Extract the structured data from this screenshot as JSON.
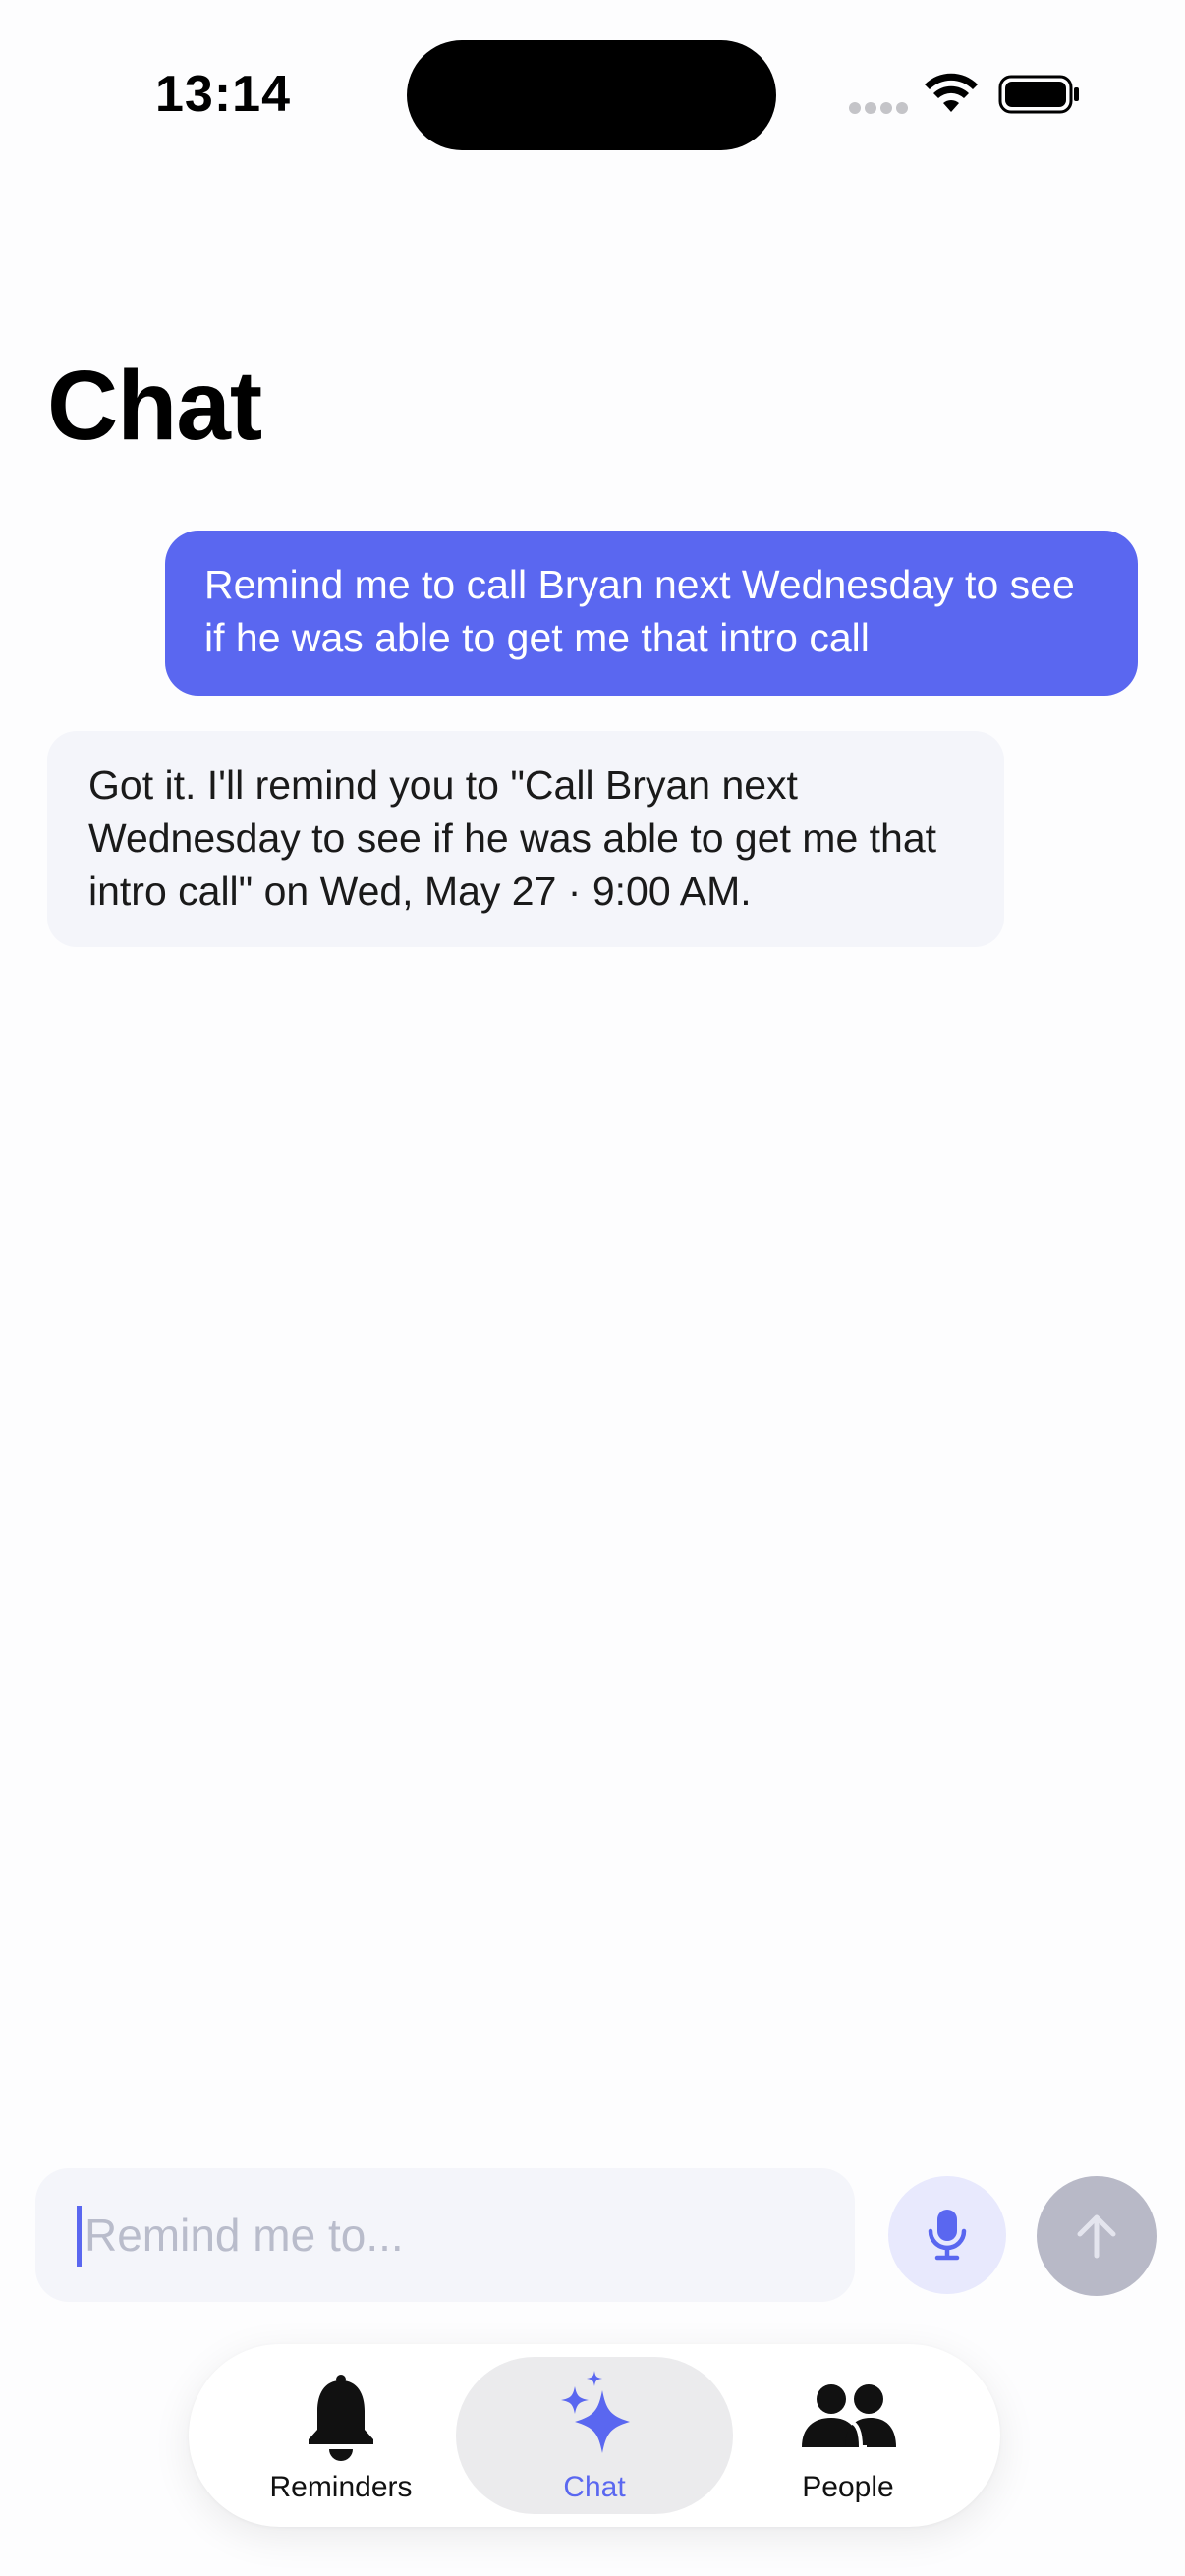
{
  "status_bar": {
    "time": "13:14"
  },
  "header": {
    "title": "Chat"
  },
  "messages": [
    {
      "role": "user",
      "text": "Remind me to call Bryan next Wednesday to see if he was able to get me that intro call"
    },
    {
      "role": "assistant",
      "text": "Got it. I'll remind you to \"Call Bryan next Wednesday to see if he was able to get me that intro call\" on Wed, May 27 · 9:00 AM."
    }
  ],
  "composer": {
    "value": "",
    "placeholder": "Remind me to...",
    "mic_icon": "microphone-icon",
    "send_icon": "arrow-up-icon"
  },
  "tab_bar": {
    "items": [
      {
        "label": "Reminders",
        "icon": "bell-icon",
        "active": false
      },
      {
        "label": "Chat",
        "icon": "sparkles-icon",
        "active": true
      },
      {
        "label": "People",
        "icon": "people-icon",
        "active": false
      }
    ]
  },
  "colors": {
    "accent": "#5a67f0",
    "user_bubble": "#5a67f0",
    "assistant_bubble": "#f4f5fa",
    "send_disabled": "#b8b9c7",
    "mic_bg": "#e8e9fd"
  }
}
